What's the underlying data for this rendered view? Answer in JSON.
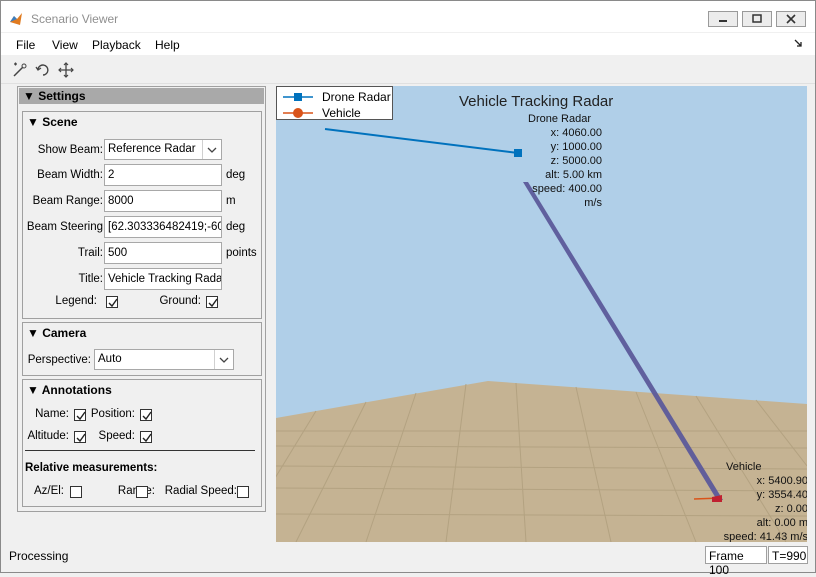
{
  "window": {
    "title": "Scenario Viewer"
  },
  "menu": {
    "file": "File",
    "view": "View",
    "playback": "Playback",
    "help": "Help"
  },
  "toolbar": {
    "tools": [
      "add-actor-icon",
      "rotate-icon",
      "pan-icon"
    ]
  },
  "settings": {
    "header": "Settings",
    "scene": {
      "title": "Scene",
      "show_beam_label": "Show Beam:",
      "show_beam_value": "Reference Radar",
      "beam_width_label": "Beam Width:",
      "beam_width_value": "2",
      "beam_width_unit": "deg",
      "beam_range_label": "Beam Range:",
      "beam_range_value": "8000",
      "beam_range_unit": "m",
      "beam_steering_label": "Beam Steering",
      "beam_steering_value": "[62.303336482419;-60.0",
      "beam_steering_unit": "deg",
      "trail_label": "Trail:",
      "trail_value": "500",
      "trail_unit": "points",
      "title_label": "Title:",
      "title_value": "Vehicle Tracking Radar",
      "legend_label": "Legend:",
      "legend_checked": true,
      "ground_label": "Ground:",
      "ground_checked": true
    },
    "camera": {
      "title": "Camera",
      "perspective_label": "Perspective:",
      "perspective_value": "Auto"
    },
    "annotations": {
      "title": "Annotations",
      "name_label": "Name:",
      "name_checked": true,
      "position_label": "Position:",
      "position_checked": true,
      "altitude_label": "Altitude:",
      "altitude_checked": true,
      "speed_label": "Speed:",
      "speed_checked": true,
      "relative_title": "Relative measurements:",
      "azel_label": "Az/El:",
      "azel_checked": false,
      "range_label": "Range:",
      "range_checked": false,
      "radial_label": "Radial Speed:",
      "radial_checked": false
    }
  },
  "plot": {
    "title": "Vehicle Tracking Radar",
    "legend": [
      {
        "label": "Drone Radar",
        "color": "#0072bd"
      },
      {
        "label": "Vehicle",
        "color": "#d95319"
      }
    ],
    "drone": {
      "name": "Drone Radar",
      "x": "x: 4060.00",
      "y": "y: 1000.00",
      "z": "z: 5000.00",
      "alt": "alt: 5.00 km",
      "speed": "speed: 400.00 m/s"
    },
    "vehicle": {
      "name": "Vehicle",
      "x": "x: 5400.90",
      "y": "y: 3554.40",
      "z": "z: 0.00",
      "alt": "alt: 0.00 m",
      "speed": "speed: 41.43 m/s"
    },
    "colors": {
      "sky": "#b0cfe8",
      "ground": "#c5b393",
      "beam": "#5c5a9a"
    }
  },
  "status": {
    "text": "Processing",
    "frame": "Frame 100",
    "time": "T=990"
  }
}
